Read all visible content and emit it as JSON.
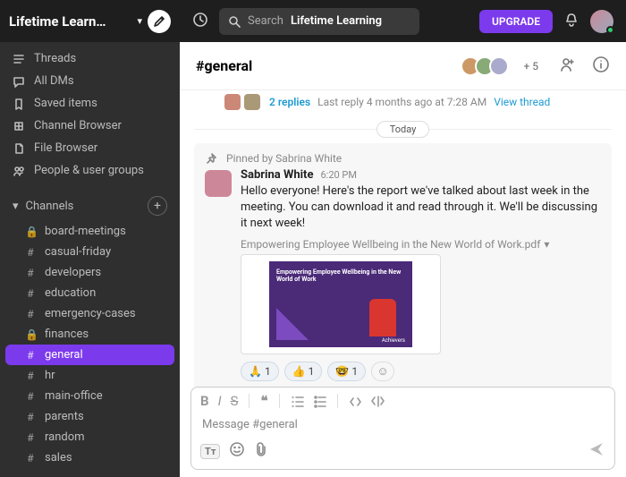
{
  "workspace": {
    "name": "Lifetime Learn…"
  },
  "nav": {
    "threads": "Threads",
    "all_dms": "All DMs",
    "saved": "Saved items",
    "channel_browser": "Channel Browser",
    "file_browser": "File Browser",
    "people": "People & user groups"
  },
  "channels_header": "Channels",
  "channels": [
    {
      "name": "board-meetings",
      "locked": true
    },
    {
      "name": "casual-friday",
      "locked": false
    },
    {
      "name": "developers",
      "locked": false
    },
    {
      "name": "education",
      "locked": false
    },
    {
      "name": "emergency-cases",
      "locked": false
    },
    {
      "name": "finances",
      "locked": true
    },
    {
      "name": "general",
      "locked": false,
      "active": true
    },
    {
      "name": "hr",
      "locked": false
    },
    {
      "name": "main-office",
      "locked": false
    },
    {
      "name": "parents",
      "locked": false
    },
    {
      "name": "random",
      "locked": false
    },
    {
      "name": "sales",
      "locked": false
    }
  ],
  "search": {
    "label": "Search",
    "value": "Lifetime Learning"
  },
  "upgrade": "UPGRADE",
  "channel_header": {
    "name": "#general",
    "more": "+ 5"
  },
  "thread_summary": {
    "replies": "2 replies",
    "meta": "Last reply 4 months ago at 7:28 AM",
    "view": "View thread"
  },
  "date": "Today",
  "pinned_by": "Pinned by Sabrina White",
  "message": {
    "author": "Sabrina White",
    "time": "6:20 PM",
    "text": "Hello everyone! Here's the report we've talked about last week in the meeting. You can download it and read through it. We'll be discussing it next week!",
    "attachment": "Empowering Employee Wellbeing in the New World of Work.pdf",
    "thumb_title": "Empowering Employee Wellbeing in the New World of Work",
    "thumb_logo": "Achievers"
  },
  "reactions": [
    {
      "emoji": "🙏",
      "count": "1"
    },
    {
      "emoji": "👍",
      "count": "1"
    },
    {
      "emoji": "🤓",
      "count": "1"
    }
  ],
  "composer": {
    "placeholder": "Message #general"
  }
}
